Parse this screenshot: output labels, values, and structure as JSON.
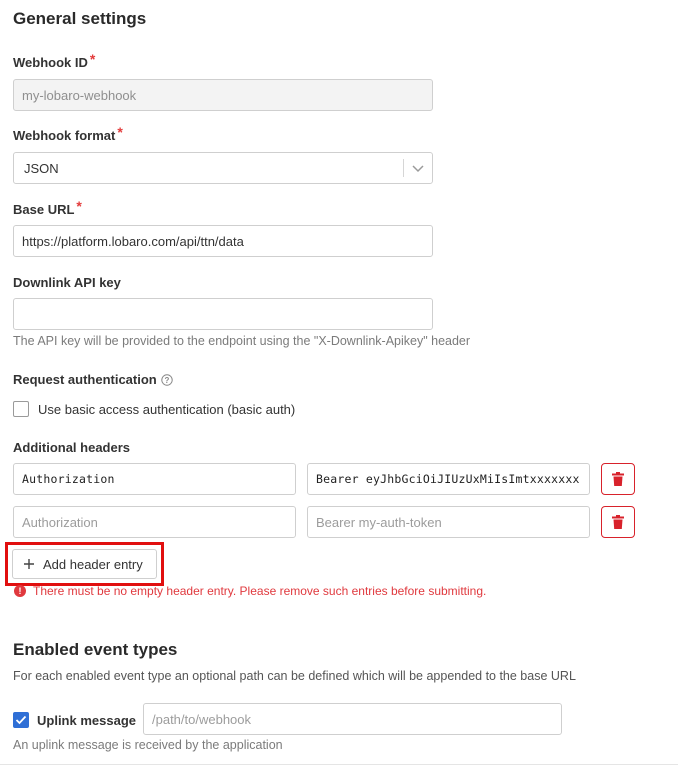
{
  "general": {
    "title": "General settings",
    "webhook_id": {
      "label": "Webhook ID",
      "required_mark": "*",
      "value": "my-lobaro-webhook"
    },
    "webhook_format": {
      "label": "Webhook format",
      "required_mark": "*",
      "value": "JSON"
    },
    "base_url": {
      "label": "Base URL",
      "required_mark": "*",
      "value": "https://platform.lobaro.com/api/ttn/data"
    },
    "downlink_api_key": {
      "label": "Downlink API key",
      "value": "",
      "help": "The API key will be provided to the endpoint using the \"X-Downlink-Apikey\" header"
    },
    "request_auth": {
      "label": "Request authentication",
      "checkbox_label": "Use basic access authentication (basic auth)",
      "checked": false
    },
    "additional_headers": {
      "label": "Additional headers",
      "rows": [
        {
          "key_value": "Authorization",
          "val_value": "Bearer eyJhbGciOiJIUzUxMiIsImtxxxxxxx",
          "key_placeholder": "",
          "val_placeholder": ""
        },
        {
          "key_value": "",
          "val_value": "",
          "key_placeholder": "Authorization",
          "val_placeholder": "Bearer my-auth-token"
        }
      ],
      "add_label": "Add header entry",
      "error": "There must be no empty header entry. Please remove such entries before submitting."
    }
  },
  "events": {
    "title": "Enabled event types",
    "description": "For each enabled event type an optional path can be defined which will be appended to the base URL",
    "uplink": {
      "label": "Uplink message",
      "checked": true,
      "path_placeholder": "/path/to/webhook",
      "help": "An uplink message is received by the application"
    }
  },
  "colors": {
    "accent": "#2f6fd6",
    "danger": "#d8222b",
    "highlight": "#e10f0f"
  }
}
